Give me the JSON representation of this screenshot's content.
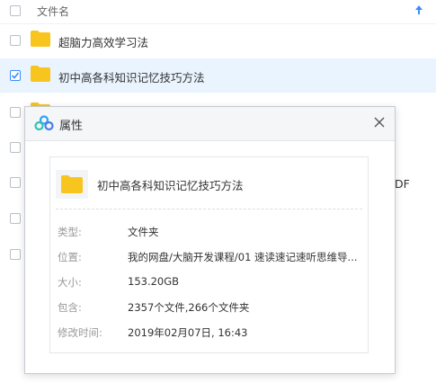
{
  "list": {
    "header_label": "文件名",
    "rows": [
      {
        "name": "超脑力高效学习法",
        "checked": false
      },
      {
        "name": "初中高各科知识记忆技巧方法",
        "checked": true
      }
    ],
    "peek_suffix": "DF"
  },
  "dialog": {
    "title": "属性",
    "file_name": "初中高各科知识记忆技巧方法",
    "props": [
      {
        "key": "类型:",
        "value": "文件夹"
      },
      {
        "key": "位置:",
        "value": "我的网盘/大脑开发课程/01 速读速记速听思维导..."
      },
      {
        "key": "大小:",
        "value": "153.20GB"
      },
      {
        "key": "包含:",
        "value": "2357个文件,266个文件夹"
      },
      {
        "key": "修改时间:",
        "value": "2019年02月07日, 16:43"
      }
    ]
  },
  "colors": {
    "folder": "#f7c51e",
    "accent": "#3b8cff",
    "selected_row": "#eaf4ff"
  },
  "icons": [
    "checkbox-icon",
    "sort-arrow-icon",
    "folder-icon",
    "baidu-cloud-icon",
    "close-icon",
    "check-icon"
  ]
}
